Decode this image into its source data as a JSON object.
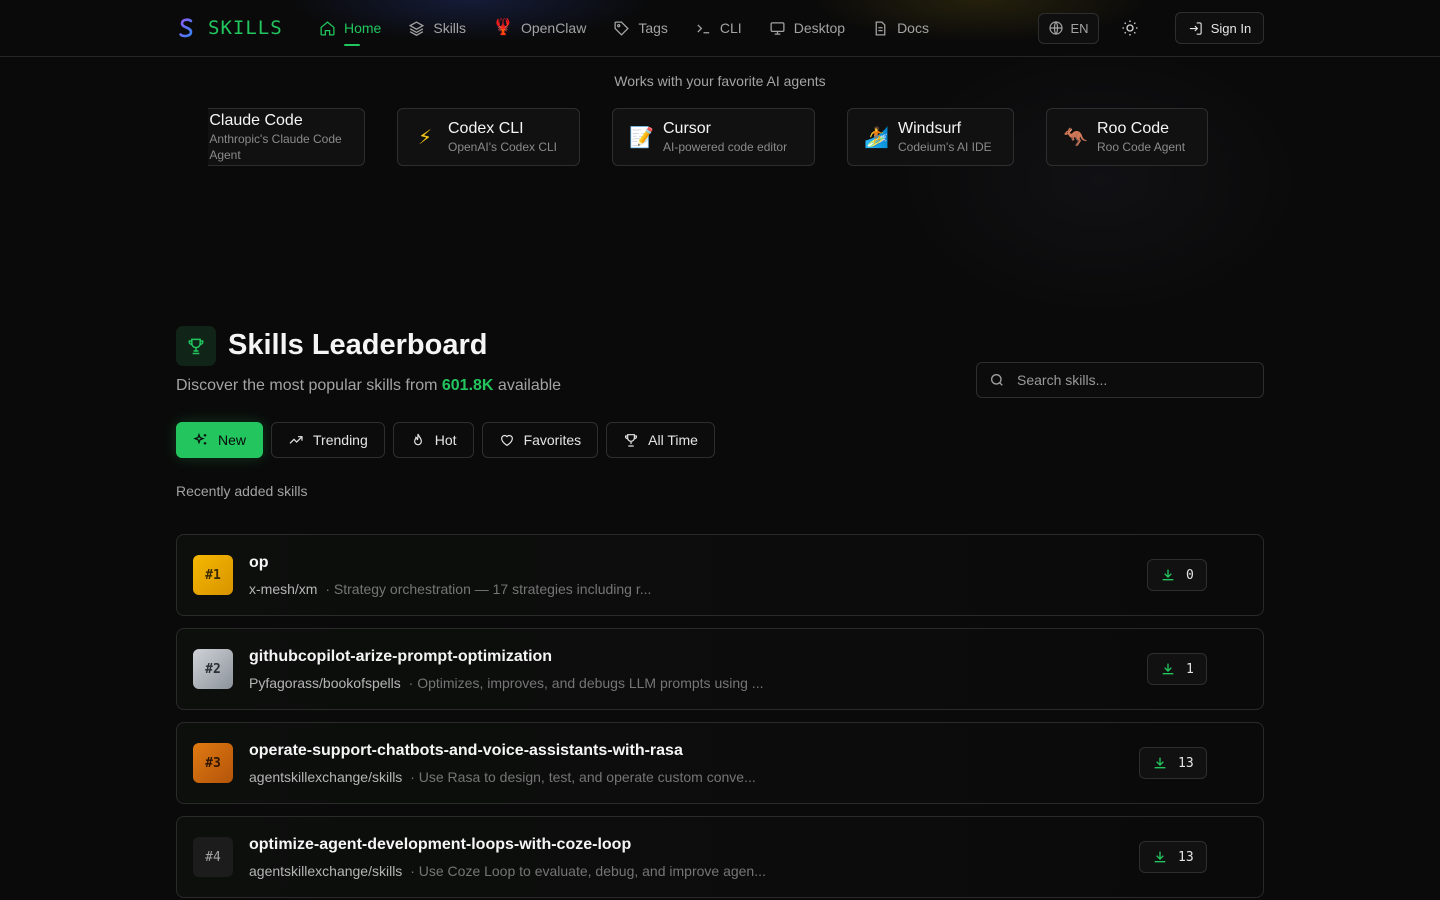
{
  "header": {
    "brand": "SKILLS",
    "nav": [
      {
        "label": "Home",
        "icon": "home-icon",
        "active": true
      },
      {
        "label": "Skills",
        "icon": "layers-icon"
      },
      {
        "label": "OpenClaw",
        "icon": "lobster-icon"
      },
      {
        "label": "Tags",
        "icon": "tag-icon"
      },
      {
        "label": "CLI",
        "icon": "terminal-icon"
      },
      {
        "label": "Desktop",
        "icon": "monitor-icon"
      },
      {
        "label": "Docs",
        "icon": "document-icon"
      }
    ],
    "language": "EN",
    "sign_in": "Sign In"
  },
  "agents": {
    "caption": "Works with your favorite AI agents",
    "items": [
      {
        "name": "Claude Code",
        "desc": "Anthropic's Claude Code Agent",
        "icon": "✳"
      },
      {
        "name": "Codex CLI",
        "desc": "OpenAI's Codex CLI",
        "icon": "⚡"
      },
      {
        "name": "Cursor",
        "desc": "AI-powered code editor",
        "icon": "📝"
      },
      {
        "name": "Windsurf",
        "desc": "Codeium's AI IDE",
        "icon": "🏄"
      },
      {
        "name": "Roo Code",
        "desc": "Roo Code Agent",
        "icon": "🦘"
      }
    ]
  },
  "leaderboard": {
    "title": "Skills Leaderboard",
    "subtitle_prefix": "Discover the most popular skills from",
    "count": "601.8K",
    "subtitle_suffix": "available",
    "search_placeholder": "Search skills...",
    "filters": [
      {
        "label": "New",
        "icon": "sparkles-icon",
        "active": true
      },
      {
        "label": "Trending",
        "icon": "trending-up-icon"
      },
      {
        "label": "Hot",
        "icon": "flame-icon"
      },
      {
        "label": "Favorites",
        "icon": "heart-icon"
      },
      {
        "label": "All Time",
        "icon": "trophy-icon"
      }
    ],
    "list_caption": "Recently added skills",
    "rows": [
      {
        "rank": "#1",
        "name": "op",
        "repo": "x-mesh/xm",
        "desc": "· Strategy orchestration — 17 strategies including r...",
        "downloads": "0"
      },
      {
        "rank": "#2",
        "name": "githubcopilot-arize-prompt-optimization",
        "repo": "Pyfagorass/bookofspells",
        "desc": "· Optimizes, improves, and debugs LLM prompts using ...",
        "downloads": "1"
      },
      {
        "rank": "#3",
        "name": "operate-support-chatbots-and-voice-assistants-with-rasa",
        "repo": "agentskillexchange/skills",
        "desc": "· Use Rasa to design, test, and operate custom conve...",
        "downloads": "13"
      },
      {
        "rank": "#4",
        "name": "optimize-agent-development-loops-with-coze-loop",
        "repo": "agentskillexchange/skills",
        "desc": "· Use Coze Loop to evaluate, debug, and improve agen...",
        "downloads": "13"
      }
    ]
  },
  "colors": {
    "accent": "#22c55e",
    "background": "#0a0a0a",
    "gold": "#f5b800",
    "silver": "#b5bac1",
    "bronze": "#d9700f"
  }
}
